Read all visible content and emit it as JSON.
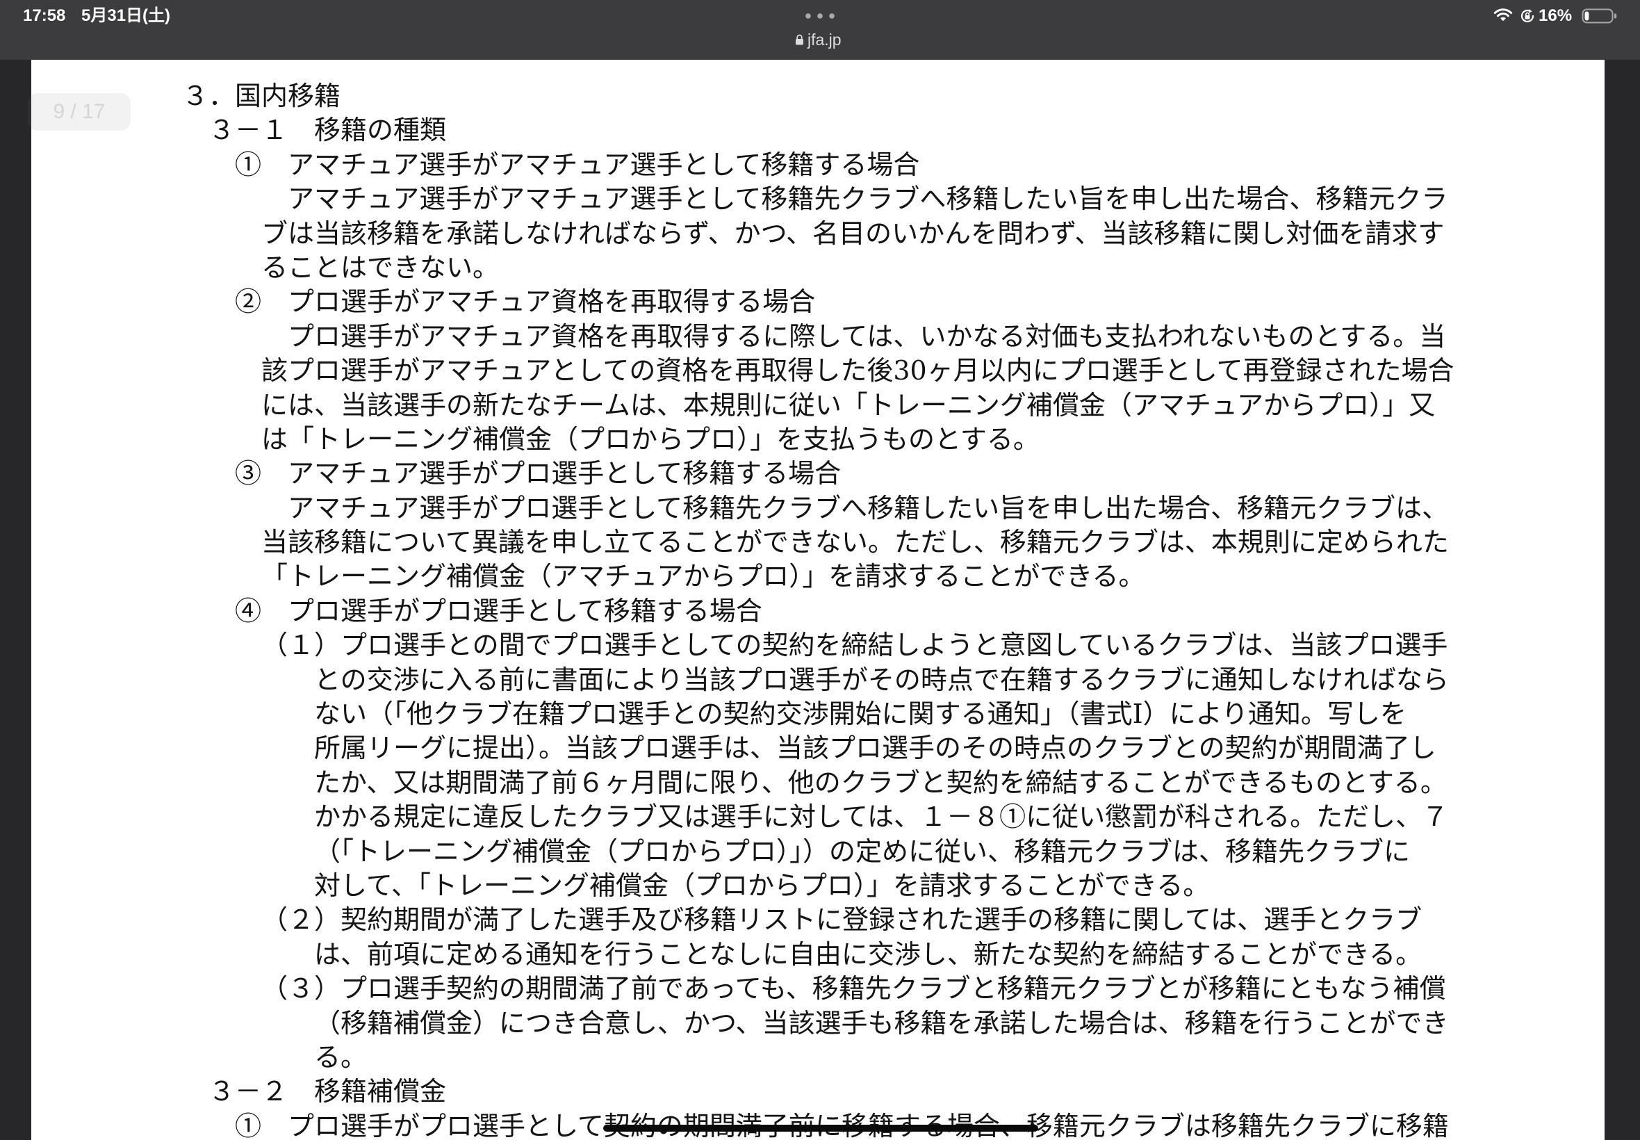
{
  "theme": {
    "status_bar": "#3c3c3e",
    "background": "#27272a",
    "page": "#ffffff",
    "text": "#141414"
  },
  "icons": {
    "multitask": "more-dots-icon",
    "secure": "lock-icon",
    "wifi": "wifi-icon",
    "orientation": "orientation-lock-icon",
    "battery": "battery-icon"
  },
  "status_bar": {
    "time": "17:58",
    "date": "5月31日(土)",
    "url": "jfa.jp",
    "battery_percent": "16%"
  },
  "viewer": {
    "page_indicator": "9 / 17"
  },
  "document": {
    "heading": "３．国内移籍",
    "sections": [
      {
        "title": "３－１　移籍の種類",
        "items": [
          {
            "title": "①　アマチュア選手がアマチュア選手として移籍する場合",
            "lines": [
              "アマチュア選手がアマチュア選手として移籍先クラブへ移籍したい旨を申し出た場合、移籍元クラ",
              "ブは当該移籍を承諾しなければならず、かつ、名目のいかんを問わず、当該移籍に関し対価を請求す",
              "ることはできない。"
            ]
          },
          {
            "title": "②　プロ選手がアマチュア資格を再取得する場合",
            "lines": [
              "プロ選手がアマチュア資格を再取得するに際しては、いかなる対価も支払われないものとする。当",
              "該プロ選手がアマチュアとしての資格を再取得した後30ヶ月以内にプロ選手として再登録された場合",
              "には、当該選手の新たなチームは、本規則に従い「トレーニング補償金（アマチュアからプロ）」又",
              "は「トレーニング補償金（プロからプロ）」を支払うものとする。"
            ]
          },
          {
            "title": "③　アマチュア選手がプロ選手として移籍する場合",
            "lines": [
              "アマチュア選手がプロ選手として移籍先クラブへ移籍したい旨を申し出た場合、移籍元クラブは、",
              "当該移籍について異議を申し立てることができない。ただし、移籍元クラブは、本規則に定められた",
              "「トレーニング補償金（アマチュアからプロ）」を請求することができる。"
            ]
          },
          {
            "title": "④　プロ選手がプロ選手として移籍する場合",
            "clauses": [
              {
                "lines": [
                  "（１）プロ選手との間でプロ選手としての契約を締結しようと意図しているクラブは、当該プロ選手",
                  "との交渉に入る前に書面により当該プロ選手がその時点で在籍するクラブに通知しなければなら",
                  "ない（「他クラブ在籍プロ選手との契約交渉開始に関する通知」（書式I）により通知。写しを",
                  "所属リーグに提出）。当該プロ選手は、当該プロ選手のその時点のクラブとの契約が期間満了し",
                  "たか、又は期間満了前６ヶ月間に限り、他のクラブと契約を締結することができるものとする。",
                  "かかる規定に違反したクラブ又は選手に対しては、１－８①に従い懲罰が科される。ただし、７",
                  "（「トレーニング補償金（プロからプロ）」）の定めに従い、移籍元クラブは、移籍先クラブに",
                  "対して、「トレーニング補償金（プロからプロ）」を請求することができる。"
                ]
              },
              {
                "lines": [
                  "（２）契約期間が満了した選手及び移籍リストに登録された選手の移籍に関しては、選手とクラブ",
                  "は、前項に定める通知を行うことなしに自由に交渉し、新たな契約を締結することができる。"
                ]
              },
              {
                "lines": [
                  "（３）プロ選手契約の期間満了前であっても、移籍先クラブと移籍元クラブとが移籍にともなう補償",
                  "（移籍補償金）につき合意し、かつ、当該選手も移籍を承諾した場合は、移籍を行うことができ",
                  "る。"
                ]
              }
            ]
          }
        ]
      },
      {
        "title": "３－２　移籍補償金",
        "items": [
          {
            "lines": [
              "①　プロ選手がプロ選手として契約の期間満了前に移籍する場合、移籍元クラブは移籍先クラブに移籍"
            ]
          }
        ]
      }
    ]
  }
}
